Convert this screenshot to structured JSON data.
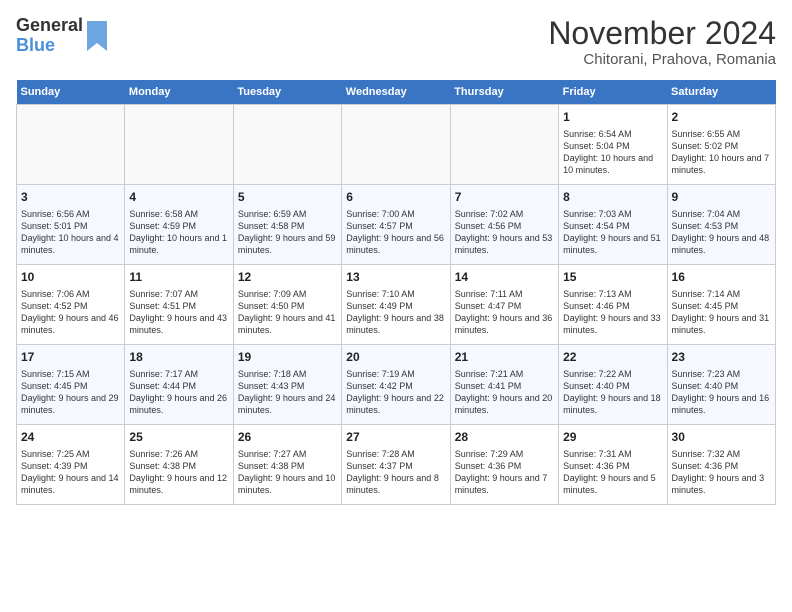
{
  "logo": {
    "line1": "General",
    "line2": "Blue"
  },
  "title": "November 2024",
  "subtitle": "Chitorani, Prahova, Romania",
  "weekdays": [
    "Sunday",
    "Monday",
    "Tuesday",
    "Wednesday",
    "Thursday",
    "Friday",
    "Saturday"
  ],
  "weeks": [
    [
      {
        "day": "",
        "content": ""
      },
      {
        "day": "",
        "content": ""
      },
      {
        "day": "",
        "content": ""
      },
      {
        "day": "",
        "content": ""
      },
      {
        "day": "",
        "content": ""
      },
      {
        "day": "1",
        "content": "Sunrise: 6:54 AM\nSunset: 5:04 PM\nDaylight: 10 hours and 10 minutes."
      },
      {
        "day": "2",
        "content": "Sunrise: 6:55 AM\nSunset: 5:02 PM\nDaylight: 10 hours and 7 minutes."
      }
    ],
    [
      {
        "day": "3",
        "content": "Sunrise: 6:56 AM\nSunset: 5:01 PM\nDaylight: 10 hours and 4 minutes."
      },
      {
        "day": "4",
        "content": "Sunrise: 6:58 AM\nSunset: 4:59 PM\nDaylight: 10 hours and 1 minute."
      },
      {
        "day": "5",
        "content": "Sunrise: 6:59 AM\nSunset: 4:58 PM\nDaylight: 9 hours and 59 minutes."
      },
      {
        "day": "6",
        "content": "Sunrise: 7:00 AM\nSunset: 4:57 PM\nDaylight: 9 hours and 56 minutes."
      },
      {
        "day": "7",
        "content": "Sunrise: 7:02 AM\nSunset: 4:56 PM\nDaylight: 9 hours and 53 minutes."
      },
      {
        "day": "8",
        "content": "Sunrise: 7:03 AM\nSunset: 4:54 PM\nDaylight: 9 hours and 51 minutes."
      },
      {
        "day": "9",
        "content": "Sunrise: 7:04 AM\nSunset: 4:53 PM\nDaylight: 9 hours and 48 minutes."
      }
    ],
    [
      {
        "day": "10",
        "content": "Sunrise: 7:06 AM\nSunset: 4:52 PM\nDaylight: 9 hours and 46 minutes."
      },
      {
        "day": "11",
        "content": "Sunrise: 7:07 AM\nSunset: 4:51 PM\nDaylight: 9 hours and 43 minutes."
      },
      {
        "day": "12",
        "content": "Sunrise: 7:09 AM\nSunset: 4:50 PM\nDaylight: 9 hours and 41 minutes."
      },
      {
        "day": "13",
        "content": "Sunrise: 7:10 AM\nSunset: 4:49 PM\nDaylight: 9 hours and 38 minutes."
      },
      {
        "day": "14",
        "content": "Sunrise: 7:11 AM\nSunset: 4:47 PM\nDaylight: 9 hours and 36 minutes."
      },
      {
        "day": "15",
        "content": "Sunrise: 7:13 AM\nSunset: 4:46 PM\nDaylight: 9 hours and 33 minutes."
      },
      {
        "day": "16",
        "content": "Sunrise: 7:14 AM\nSunset: 4:45 PM\nDaylight: 9 hours and 31 minutes."
      }
    ],
    [
      {
        "day": "17",
        "content": "Sunrise: 7:15 AM\nSunset: 4:45 PM\nDaylight: 9 hours and 29 minutes."
      },
      {
        "day": "18",
        "content": "Sunrise: 7:17 AM\nSunset: 4:44 PM\nDaylight: 9 hours and 26 minutes."
      },
      {
        "day": "19",
        "content": "Sunrise: 7:18 AM\nSunset: 4:43 PM\nDaylight: 9 hours and 24 minutes."
      },
      {
        "day": "20",
        "content": "Sunrise: 7:19 AM\nSunset: 4:42 PM\nDaylight: 9 hours and 22 minutes."
      },
      {
        "day": "21",
        "content": "Sunrise: 7:21 AM\nSunset: 4:41 PM\nDaylight: 9 hours and 20 minutes."
      },
      {
        "day": "22",
        "content": "Sunrise: 7:22 AM\nSunset: 4:40 PM\nDaylight: 9 hours and 18 minutes."
      },
      {
        "day": "23",
        "content": "Sunrise: 7:23 AM\nSunset: 4:40 PM\nDaylight: 9 hours and 16 minutes."
      }
    ],
    [
      {
        "day": "24",
        "content": "Sunrise: 7:25 AM\nSunset: 4:39 PM\nDaylight: 9 hours and 14 minutes."
      },
      {
        "day": "25",
        "content": "Sunrise: 7:26 AM\nSunset: 4:38 PM\nDaylight: 9 hours and 12 minutes."
      },
      {
        "day": "26",
        "content": "Sunrise: 7:27 AM\nSunset: 4:38 PM\nDaylight: 9 hours and 10 minutes."
      },
      {
        "day": "27",
        "content": "Sunrise: 7:28 AM\nSunset: 4:37 PM\nDaylight: 9 hours and 8 minutes."
      },
      {
        "day": "28",
        "content": "Sunrise: 7:29 AM\nSunset: 4:36 PM\nDaylight: 9 hours and 7 minutes."
      },
      {
        "day": "29",
        "content": "Sunrise: 7:31 AM\nSunset: 4:36 PM\nDaylight: 9 hours and 5 minutes."
      },
      {
        "day": "30",
        "content": "Sunrise: 7:32 AM\nSunset: 4:36 PM\nDaylight: 9 hours and 3 minutes."
      }
    ]
  ]
}
